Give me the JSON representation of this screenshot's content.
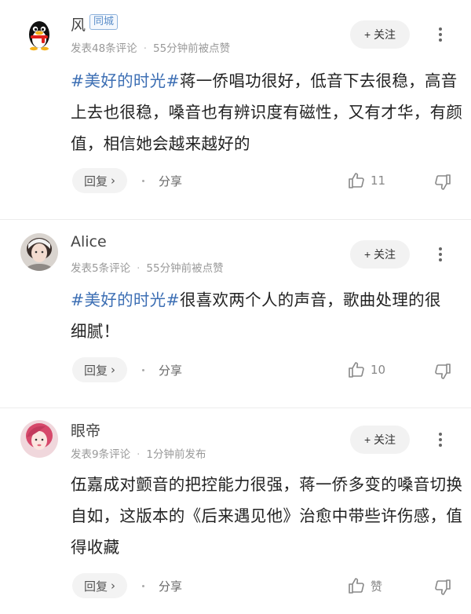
{
  "comments": [
    {
      "username": "风",
      "badge": "同城",
      "meta_count": "发表48条评论",
      "meta_time": "55分钟前被点赞",
      "follow_label": "+ 关注",
      "tag": "#美好的时光#",
      "text": "蒋一侨唱功很好，低音下去很稳，高音上去也很稳，嗓音也有辨识度有磁性，又有才华，有颜值，相信她会越来越好的",
      "reply_label": "回复",
      "share_label": "分享",
      "likes": "11"
    },
    {
      "username": "Alice",
      "meta_count": "发表5条评论",
      "meta_time": "55分钟前被点赞",
      "follow_label": "+ 关注",
      "tag": "#美好的时光#",
      "text": "很喜欢两个人的声音，歌曲处理的很细腻！",
      "reply_label": "回复",
      "share_label": "分享",
      "likes": "10"
    },
    {
      "username": "眼帝",
      "meta_count": "发表9条评论",
      "meta_time": "1分钟前发布",
      "follow_label": "+ 关注",
      "text": "伍嘉成对颤音的把控能力很强，蒋一侨多变的嗓音切换自如，这版本的《后来遇见他》治愈中带些许伤感，值得收藏",
      "reply_label": "回复",
      "share_label": "分享",
      "likes": "赞"
    }
  ],
  "colors": {
    "tag": "#3d6fb4",
    "badge": "#5b8ec9"
  },
  "icons": [
    "penguin-avatar",
    "thumbs-up-icon",
    "thumbs-down-icon",
    "chevron-right-icon",
    "more-vertical-icon"
  ]
}
